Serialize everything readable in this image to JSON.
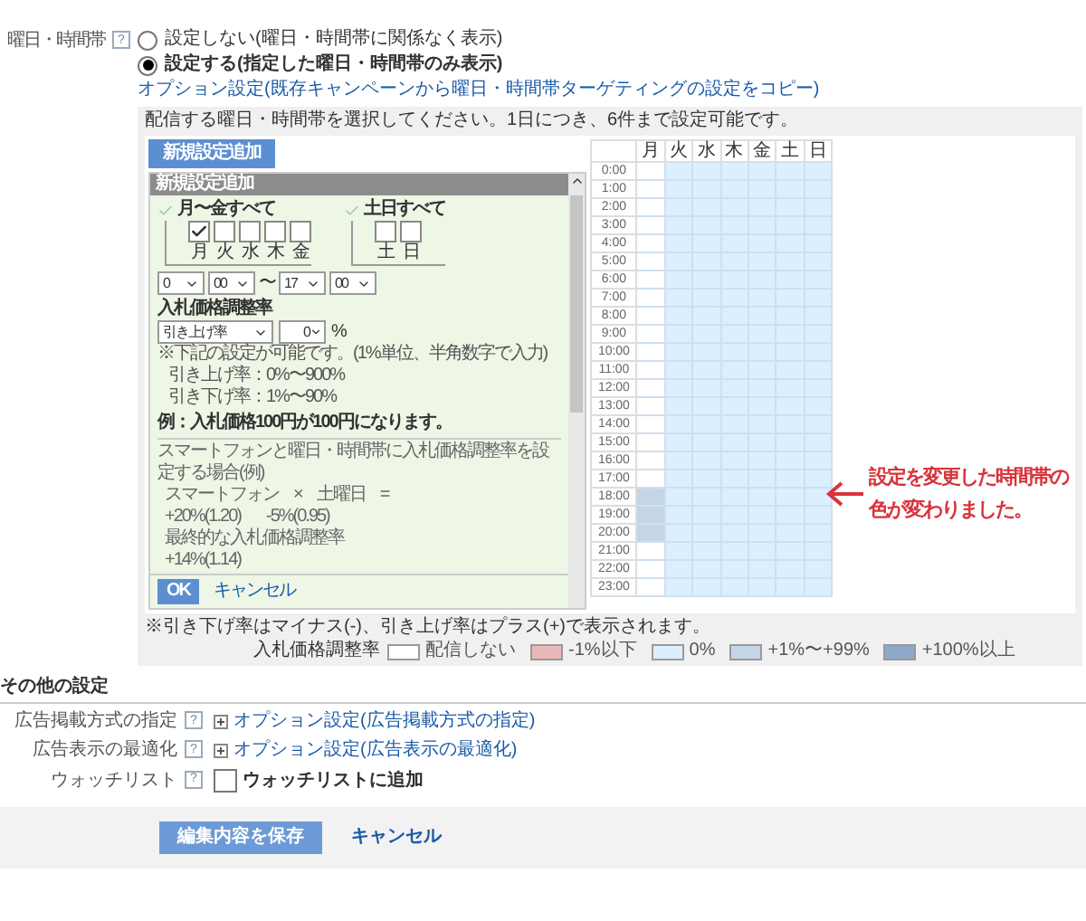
{
  "schedule_setting": {
    "label": "曜日・時間帯",
    "help": "?",
    "options": [
      {
        "label": "設定しない(曜日・時間帯に関係なく表示)",
        "selected": false
      },
      {
        "label": "設定する(指定した曜日・時間帯のみ表示)",
        "selected": true
      }
    ],
    "copy_link": "オプション設定(既存キャンペーンから曜日・時間帯ターゲティングの設定をコピー)"
  },
  "panel": {
    "instruction": "配信する曜日・時間帯を選択してください。1日につき、6件まで設定可能です。",
    "add_button": "新規設定追加",
    "editor": {
      "title": "新規設定追加",
      "groups": [
        {
          "label": "月〜金すべて",
          "days": [
            {
              "label": "月",
              "checked": true
            },
            {
              "label": "火",
              "checked": false
            },
            {
              "label": "水",
              "checked": false
            },
            {
              "label": "木",
              "checked": false
            },
            {
              "label": "金",
              "checked": false
            }
          ]
        },
        {
          "label": "土日すべて",
          "days": [
            {
              "label": "土",
              "checked": false
            },
            {
              "label": "日",
              "checked": false
            }
          ]
        }
      ],
      "start_hour": "0",
      "start_minute": "00",
      "separator": "〜",
      "end_hour": "17",
      "end_minute": "00",
      "rate_title": "入札価格調整率",
      "rate_type": "引き上げ率",
      "rate_value": "0",
      "rate_unit": "%",
      "notes": [
        "※下記の設定が可能です。(1%単位、半角数字で入力)",
        "引き上げ率：0%〜900%",
        "引き下げ率：1%〜90%"
      ],
      "example": "例：入札価格100円が100円になります。",
      "combo_title": "スマートフォンと曜日・時間帯に入札価格調整率を設定する場合(例)",
      "combo_names": [
        "スマートフォン",
        "×",
        "土曜日",
        "="
      ],
      "combo_values": [
        "+20%(1.20)",
        "-5%(0.95)"
      ],
      "final_title": "最終的な入札価格調整率",
      "final_value": "+14%(1.14)",
      "ok": "OK",
      "cancel": "キャンセル"
    },
    "grid": {
      "days": [
        "月",
        "火",
        "水",
        "木",
        "金",
        "土",
        "日"
      ],
      "rows": [
        {
          "time": "0:00",
          "cells": [
            {
              "kind": "none"
            },
            {
              "kind": "zero"
            },
            {
              "kind": "zero"
            },
            {
              "kind": "zero"
            },
            {
              "kind": "zero"
            },
            {
              "kind": "zero"
            },
            {
              "kind": "zero"
            }
          ]
        },
        {
          "time": "1:00",
          "cells": [
            {
              "kind": "none"
            },
            {
              "kind": "zero"
            },
            {
              "kind": "zero"
            },
            {
              "kind": "zero"
            },
            {
              "kind": "zero"
            },
            {
              "kind": "zero"
            },
            {
              "kind": "zero"
            }
          ]
        },
        {
          "time": "2:00",
          "cells": [
            {
              "kind": "none"
            },
            {
              "kind": "zero"
            },
            {
              "kind": "zero"
            },
            {
              "kind": "zero"
            },
            {
              "kind": "zero"
            },
            {
              "kind": "zero"
            },
            {
              "kind": "zero"
            }
          ]
        },
        {
          "time": "3:00",
          "cells": [
            {
              "kind": "none"
            },
            {
              "kind": "zero"
            },
            {
              "kind": "zero"
            },
            {
              "kind": "zero"
            },
            {
              "kind": "zero"
            },
            {
              "kind": "zero"
            },
            {
              "kind": "zero"
            }
          ]
        },
        {
          "time": "4:00",
          "cells": [
            {
              "kind": "none"
            },
            {
              "kind": "zero"
            },
            {
              "kind": "zero"
            },
            {
              "kind": "zero"
            },
            {
              "kind": "zero"
            },
            {
              "kind": "zero"
            },
            {
              "kind": "zero"
            }
          ]
        },
        {
          "time": "5:00",
          "cells": [
            {
              "kind": "none"
            },
            {
              "kind": "zero"
            },
            {
              "kind": "zero"
            },
            {
              "kind": "zero"
            },
            {
              "kind": "zero"
            },
            {
              "kind": "zero"
            },
            {
              "kind": "zero"
            }
          ]
        },
        {
          "time": "6:00",
          "cells": [
            {
              "kind": "none"
            },
            {
              "kind": "zero"
            },
            {
              "kind": "zero"
            },
            {
              "kind": "zero"
            },
            {
              "kind": "zero"
            },
            {
              "kind": "zero"
            },
            {
              "kind": "zero"
            }
          ]
        },
        {
          "time": "7:00",
          "cells": [
            {
              "kind": "none"
            },
            {
              "kind": "zero"
            },
            {
              "kind": "zero"
            },
            {
              "kind": "zero"
            },
            {
              "kind": "zero"
            },
            {
              "kind": "zero"
            },
            {
              "kind": "zero"
            }
          ]
        },
        {
          "time": "8:00",
          "cells": [
            {
              "kind": "none"
            },
            {
              "kind": "zero"
            },
            {
              "kind": "zero"
            },
            {
              "kind": "zero"
            },
            {
              "kind": "zero"
            },
            {
              "kind": "zero"
            },
            {
              "kind": "zero"
            }
          ]
        },
        {
          "time": "9:00",
          "cells": [
            {
              "kind": "none"
            },
            {
              "kind": "zero"
            },
            {
              "kind": "zero"
            },
            {
              "kind": "zero"
            },
            {
              "kind": "zero"
            },
            {
              "kind": "zero"
            },
            {
              "kind": "zero"
            }
          ]
        },
        {
          "time": "10:00",
          "cells": [
            {
              "kind": "none"
            },
            {
              "kind": "zero"
            },
            {
              "kind": "zero"
            },
            {
              "kind": "zero"
            },
            {
              "kind": "zero"
            },
            {
              "kind": "zero"
            },
            {
              "kind": "zero"
            }
          ]
        },
        {
          "time": "11:00",
          "cells": [
            {
              "kind": "none"
            },
            {
              "kind": "zero"
            },
            {
              "kind": "zero"
            },
            {
              "kind": "zero"
            },
            {
              "kind": "zero"
            },
            {
              "kind": "zero"
            },
            {
              "kind": "zero"
            }
          ]
        },
        {
          "time": "12:00",
          "cells": [
            {
              "kind": "none"
            },
            {
              "kind": "zero"
            },
            {
              "kind": "zero"
            },
            {
              "kind": "zero"
            },
            {
              "kind": "zero"
            },
            {
              "kind": "zero"
            },
            {
              "kind": "zero"
            }
          ]
        },
        {
          "time": "13:00",
          "cells": [
            {
              "kind": "none"
            },
            {
              "kind": "zero"
            },
            {
              "kind": "zero"
            },
            {
              "kind": "zero"
            },
            {
              "kind": "zero"
            },
            {
              "kind": "zero"
            },
            {
              "kind": "zero"
            }
          ]
        },
        {
          "time": "14:00",
          "cells": [
            {
              "kind": "none"
            },
            {
              "kind": "zero"
            },
            {
              "kind": "zero"
            },
            {
              "kind": "zero"
            },
            {
              "kind": "zero"
            },
            {
              "kind": "zero"
            },
            {
              "kind": "zero"
            }
          ]
        },
        {
          "time": "15:00",
          "cells": [
            {
              "kind": "none"
            },
            {
              "kind": "zero"
            },
            {
              "kind": "zero"
            },
            {
              "kind": "zero"
            },
            {
              "kind": "zero"
            },
            {
              "kind": "zero"
            },
            {
              "kind": "zero"
            }
          ]
        },
        {
          "time": "16:00",
          "cells": [
            {
              "kind": "none"
            },
            {
              "kind": "zero"
            },
            {
              "kind": "zero"
            },
            {
              "kind": "zero"
            },
            {
              "kind": "zero"
            },
            {
              "kind": "zero"
            },
            {
              "kind": "zero"
            }
          ]
        },
        {
          "time": "17:00",
          "cells": [
            {
              "kind": "none"
            },
            {
              "kind": "zero"
            },
            {
              "kind": "zero"
            },
            {
              "kind": "zero"
            },
            {
              "kind": "zero"
            },
            {
              "kind": "zero"
            },
            {
              "kind": "zero"
            }
          ]
        },
        {
          "time": "18:00",
          "cells": [
            {
              "kind": "plus"
            },
            {
              "kind": "zero"
            },
            {
              "kind": "zero"
            },
            {
              "kind": "zero"
            },
            {
              "kind": "zero"
            },
            {
              "kind": "zero"
            },
            {
              "kind": "zero"
            }
          ]
        },
        {
          "time": "19:00",
          "cells": [
            {
              "kind": "plus"
            },
            {
              "kind": "zero"
            },
            {
              "kind": "zero"
            },
            {
              "kind": "zero"
            },
            {
              "kind": "zero"
            },
            {
              "kind": "zero"
            },
            {
              "kind": "zero"
            }
          ]
        },
        {
          "time": "20:00",
          "cells": [
            {
              "kind": "plus"
            },
            {
              "kind": "zero"
            },
            {
              "kind": "zero"
            },
            {
              "kind": "zero"
            },
            {
              "kind": "zero"
            },
            {
              "kind": "zero"
            },
            {
              "kind": "zero"
            }
          ]
        },
        {
          "time": "21:00",
          "cells": [
            {
              "kind": "none"
            },
            {
              "kind": "zero"
            },
            {
              "kind": "zero"
            },
            {
              "kind": "zero"
            },
            {
              "kind": "zero"
            },
            {
              "kind": "zero"
            },
            {
              "kind": "zero"
            }
          ]
        },
        {
          "time": "22:00",
          "cells": [
            {
              "kind": "none"
            },
            {
              "kind": "zero"
            },
            {
              "kind": "zero"
            },
            {
              "kind": "zero"
            },
            {
              "kind": "zero"
            },
            {
              "kind": "zero"
            },
            {
              "kind": "zero"
            }
          ]
        },
        {
          "time": "23:00",
          "cells": [
            {
              "kind": "none"
            },
            {
              "kind": "zero"
            },
            {
              "kind": "zero"
            },
            {
              "kind": "zero"
            },
            {
              "kind": "zero"
            },
            {
              "kind": "zero"
            },
            {
              "kind": "zero"
            }
          ]
        }
      ]
    },
    "annotation": [
      "設定を変更した時間帯の",
      "色が変わりました。"
    ],
    "note": "※引き下げ率はマイナス(-)、引き上げ率はプラス(+)で表示されます。",
    "legend": {
      "title": "入札価格調整率",
      "items": [
        {
          "kind": "none",
          "label": "配信しない"
        },
        {
          "kind": "minus",
          "label": "-1%以下"
        },
        {
          "kind": "zero",
          "label": "0%"
        },
        {
          "kind": "plus",
          "label": "+1%〜+99%"
        },
        {
          "kind": "plus100",
          "label": "+100%以上"
        }
      ]
    }
  },
  "other_settings": {
    "title": "その他の設定",
    "rows": [
      {
        "kind": "link",
        "label": "広告掲載方式の指定",
        "help": "?",
        "value": "オプション設定(広告掲載方式の指定)"
      },
      {
        "kind": "link",
        "label": "広告表示の最適化",
        "help": "?",
        "value": "オプション設定(広告表示の最適化)"
      },
      {
        "kind": "checkbox",
        "label": "ウォッチリスト",
        "help": "?",
        "value": "ウォッチリストに追加",
        "checked": false
      }
    ]
  },
  "footer": {
    "save": "編集内容を保存",
    "cancel": "キャンセル"
  }
}
